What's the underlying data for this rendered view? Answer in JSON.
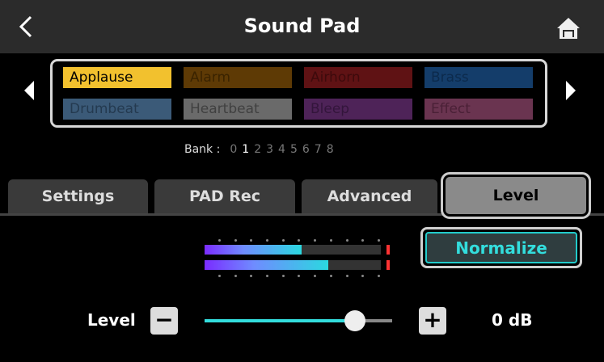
{
  "header": {
    "title": "Sound Pad",
    "back_icon": "chevron-left-icon",
    "home_icon": "home-icon"
  },
  "pads": [
    {
      "label": "Applause",
      "color": "#f2c12e",
      "text": "#000",
      "active": true
    },
    {
      "label": "Alarm",
      "color": "#5e3a05",
      "text": "#3a2300"
    },
    {
      "label": "Airhorn",
      "color": "#5f1214",
      "text": "#3d0a0c"
    },
    {
      "label": "Brass",
      "color": "#143d6a",
      "text": "#0c2a4c"
    },
    {
      "label": "Drumbeat",
      "color": "#3b5a78",
      "text": "#243a50"
    },
    {
      "label": "Heartbeat",
      "color": "#6a6a6a",
      "text": "#404040"
    },
    {
      "label": "Bleep",
      "color": "#4e2358",
      "text": "#33153b"
    },
    {
      "label": "Effect",
      "color": "#6a3450",
      "text": "#4a2036"
    }
  ],
  "bank": {
    "label": "Bank :",
    "numbers": [
      "0",
      "1",
      "2",
      "3",
      "4",
      "5",
      "6",
      "7",
      "8"
    ],
    "selected": "1"
  },
  "tabs": [
    {
      "label": "Settings"
    },
    {
      "label": "PAD Rec"
    },
    {
      "label": "Advanced"
    },
    {
      "label": "Level",
      "selected": true
    }
  ],
  "normalize_label": "Normalize",
  "meter": {
    "left_percent": 55,
    "right_percent": 70
  },
  "level": {
    "label": "Level",
    "minus": "−",
    "plus": "+",
    "value": "0 dB",
    "slider_percent": 80
  }
}
